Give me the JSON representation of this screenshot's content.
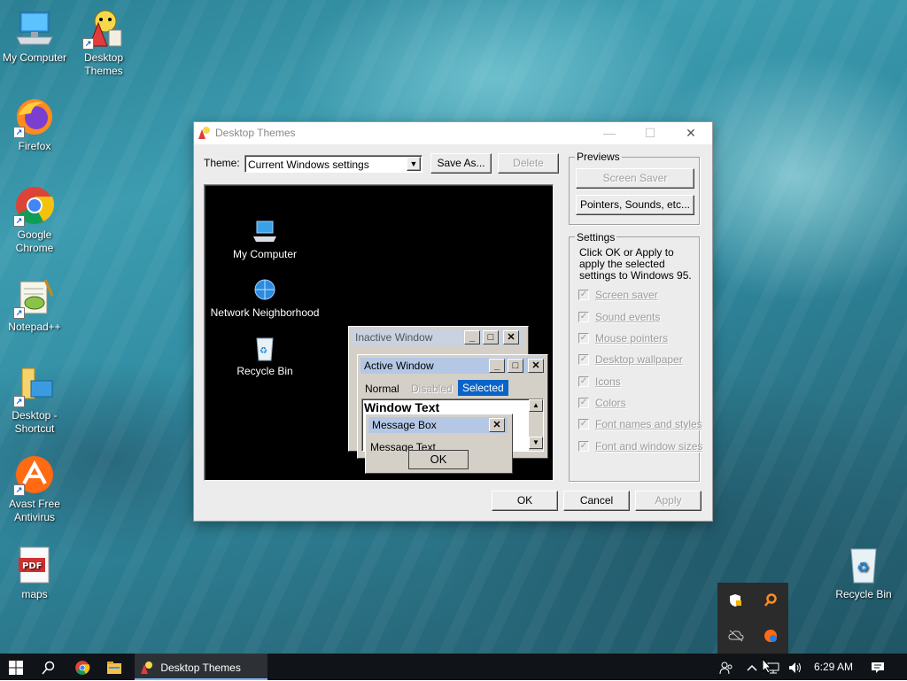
{
  "desktop": {
    "icons": [
      {
        "label": "My Computer"
      },
      {
        "label": "Desktop Themes"
      },
      {
        "label": "Firefox"
      },
      {
        "label": "Google Chrome"
      },
      {
        "label": "Notepad++"
      },
      {
        "label": "Desktop - Shortcut"
      },
      {
        "label": "Avast Free Antivirus"
      },
      {
        "label": "maps"
      },
      {
        "label": "Recycle Bin"
      }
    ]
  },
  "dialog": {
    "title": "Desktop Themes",
    "theme_label": "Theme:",
    "theme_value": "Current Windows settings",
    "save_as_label": "Save As...",
    "delete_label": "Delete",
    "previews": {
      "label": "Previews",
      "screen_saver_label": "Screen Saver",
      "pointers_label": "Pointers, Sounds, etc..."
    },
    "settings": {
      "label": "Settings",
      "description": "Click OK or Apply to apply the selected settings to Windows 95.",
      "checkboxes": [
        {
          "label": "Screen saver",
          "checked": true
        },
        {
          "label": "Sound events",
          "checked": true
        },
        {
          "label": "Mouse pointers",
          "checked": true
        },
        {
          "label": "Desktop wallpaper",
          "checked": true
        },
        {
          "label": "Icons",
          "checked": true
        },
        {
          "label": "Colors",
          "checked": true
        },
        {
          "label": "Font names and styles",
          "checked": true
        },
        {
          "label": "Font and window sizes",
          "checked": true
        }
      ]
    },
    "preview": {
      "icons": [
        {
          "label": "My Computer"
        },
        {
          "label": "Network Neighborhood"
        },
        {
          "label": "Recycle Bin"
        }
      ],
      "inactive_window_title": "Inactive Window",
      "active_window_title": "Active Window",
      "menu_normal": "Normal",
      "menu_disabled": "Disabled",
      "menu_selected": "Selected",
      "window_text": "Window Text",
      "message_box_title": "Message Box",
      "message_text": "Message Text",
      "ok_label": "OK"
    },
    "ok_label": "OK",
    "cancel_label": "Cancel",
    "apply_label": "Apply"
  },
  "taskbar": {
    "active_app_label": "Desktop Themes",
    "clock": "6:29 AM"
  },
  "colors": {
    "active_title": "#b4c8e6",
    "selected": "#0a64c8",
    "taskbar": "#101317"
  }
}
